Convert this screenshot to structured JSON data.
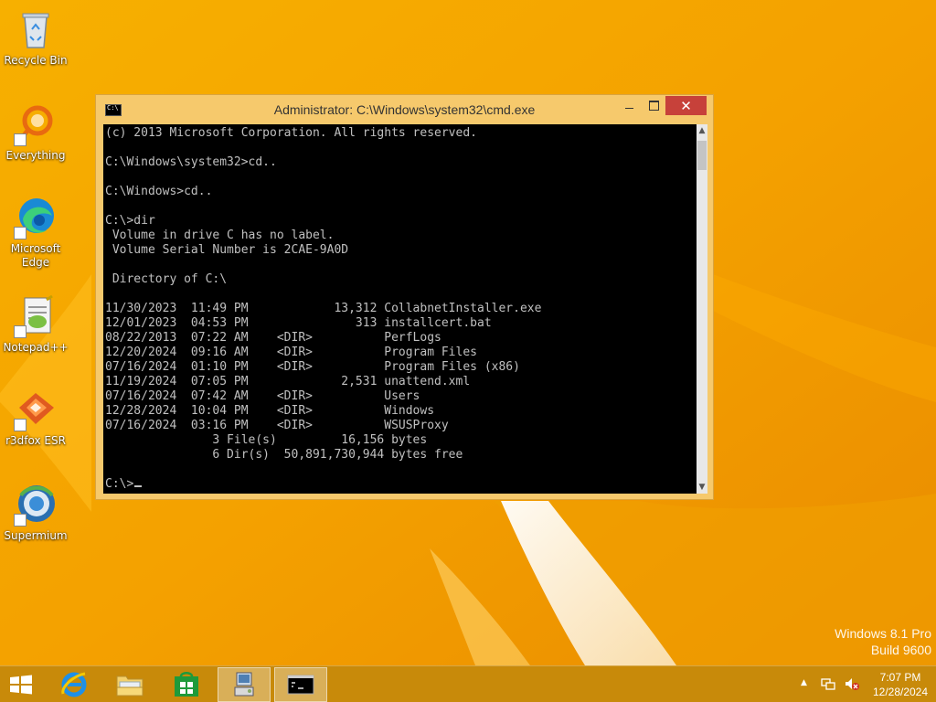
{
  "desktop": {
    "icons": [
      {
        "label": "Recycle Bin",
        "icon": "recycle-bin-icon"
      },
      {
        "label": "Everything",
        "icon": "everything-search-icon"
      },
      {
        "label": "Microsoft Edge",
        "icon": "edge-browser-icon"
      },
      {
        "label": "Notepad++",
        "icon": "notepad-plus-plus-icon"
      },
      {
        "label": "r3dfox ESR",
        "icon": "r3dfox-browser-icon"
      },
      {
        "label": "Supermium",
        "icon": "supermium-browser-icon"
      }
    ]
  },
  "window": {
    "title": "Administrator: C:\\Windows\\system32\\cmd.exe",
    "close_symbol": "✕",
    "console_lines": [
      "(c) 2013 Microsoft Corporation. All rights reserved.",
      "",
      "C:\\Windows\\system32>cd..",
      "",
      "C:\\Windows>cd..",
      "",
      "C:\\>dir",
      " Volume in drive C has no label.",
      " Volume Serial Number is 2CAE-9A0D",
      "",
      " Directory of C:\\",
      "",
      "11/30/2023  11:49 PM            13,312 CollabnetInstaller.exe",
      "12/01/2023  04:53 PM               313 installcert.bat",
      "08/22/2013  07:22 AM    <DIR>          PerfLogs",
      "12/20/2024  09:16 AM    <DIR>          Program Files",
      "07/16/2024  01:10 PM    <DIR>          Program Files (x86)",
      "11/19/2024  07:05 PM             2,531 unattend.xml",
      "07/16/2024  07:42 AM    <DIR>          Users",
      "12/28/2024  10:04 PM    <DIR>          Windows",
      "07/16/2024  03:16 PM    <DIR>          WSUSProxy",
      "               3 File(s)         16,156 bytes",
      "               6 Dir(s)  50,891,730,944 bytes free",
      ""
    ],
    "prompt": "C:\\>"
  },
  "watermark": {
    "line1": "Windows 8.1 Pro",
    "line2": "Build 9600"
  },
  "taskbar": {
    "items": [
      "start-button",
      "internet-explorer",
      "file-explorer",
      "windows-store",
      "pinned-app",
      "command-prompt"
    ],
    "active": "command-prompt"
  },
  "tray": {
    "chevron": "▲",
    "time": "7:07 PM",
    "date": "12/28/2024"
  },
  "colors": {
    "wallpaper": "#f5a300",
    "taskbar": "#c88a0a",
    "window_frame": "#f6c96c",
    "close_button": "#c7413a",
    "console_bg": "#000000",
    "console_text": "#c0c0c0"
  }
}
